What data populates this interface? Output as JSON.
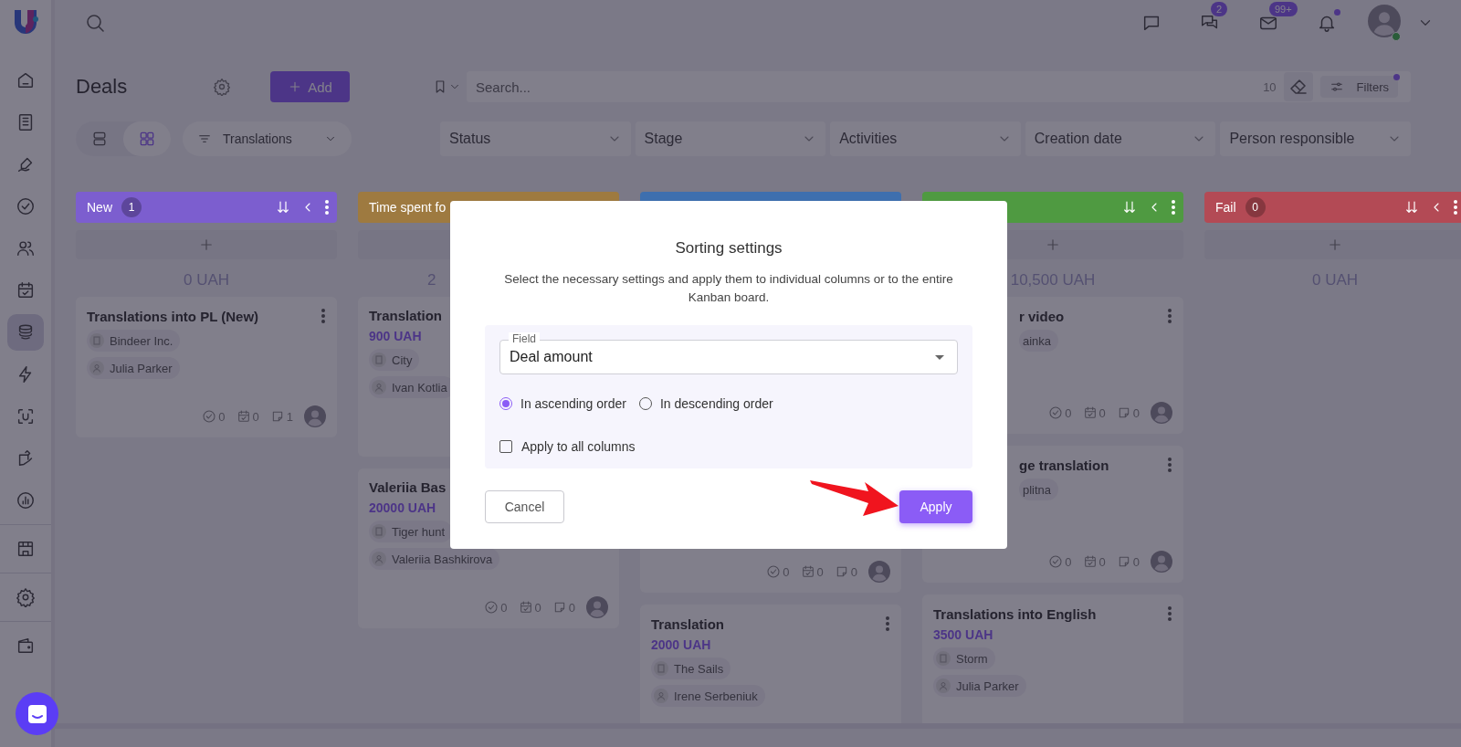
{
  "sidebar": {
    "groups": [
      [
        {
          "selected": false
        },
        {
          "selected": false
        },
        {
          "selected": false
        },
        {
          "selected": false
        },
        {
          "selected": false
        },
        {
          "selected": false
        },
        {
          "selected": true
        },
        {
          "selected": false
        },
        {
          "selected": false
        },
        {
          "selected": false
        },
        {
          "selected": false
        }
      ],
      [
        {
          "selected": false
        }
      ],
      [
        {
          "selected": false
        }
      ],
      [
        {
          "selected": false
        }
      ]
    ]
  },
  "top_actions": [
    {
      "unread": false
    },
    {
      "badge": "2"
    },
    {
      "badge": "99+"
    },
    {
      "unread": true
    }
  ],
  "user": {
    "online": true
  },
  "page": {
    "title": "Deals",
    "add_button": "Add"
  },
  "search": {
    "placeholder": "Search...",
    "count": "10",
    "filters_label": "Filters",
    "filters_active": true
  },
  "view_toggle": [
    {
      "selected": false
    },
    {
      "selected": true
    }
  ],
  "pipeline": {
    "value": "Translations"
  },
  "filters": [
    "Status",
    "Stage",
    "Activities",
    "Creation date",
    "Person responsible"
  ],
  "columns": [
    {
      "title": "New",
      "count": "1",
      "color": "#7c5ecf",
      "actions": true,
      "total": "0 UAH",
      "cards": [
        {
          "title": "Translations into PL (New)",
          "menu": true,
          "company": "Bindeer Inc.",
          "person": "Julia Parker",
          "tasks": "0",
          "events": "0",
          "comments": "1"
        }
      ]
    },
    {
      "title": "Time spent fo",
      "color": "#9e7a40",
      "actions": false,
      "total": "2",
      "cards": [
        {
          "title": "Translation",
          "menu": false,
          "amount": "900 UAH",
          "company": "City",
          "person": "Ivan Kotlia"
        },
        {
          "title": "Valeriia Bas",
          "menu": false,
          "amount": "20000 UAH",
          "company": "Tiger hunt",
          "person": "Valeriia Bashkirova",
          "tasks": "0",
          "events": "0",
          "comments": "0"
        }
      ]
    },
    {
      "color": "#3e6fae",
      "actions": false,
      "cards": [
        {
          "tasks": "0",
          "events": "0",
          "comments": "0"
        },
        {
          "title": "Translation",
          "menu": true,
          "amount": "2000 UAH",
          "company": "The Sails",
          "person": "Irene Serbeniuk"
        }
      ]
    },
    {
      "color": "#4f9a41",
      "actions": true,
      "total": "10,500 UAH",
      "cards": [
        {
          "title": "r video",
          "menu": true,
          "person": "ainka",
          "tasks": "0",
          "events": "0",
          "comments": "0"
        },
        {
          "title": "ge translation",
          "menu": true,
          "person": "plitna",
          "tasks": "0",
          "events": "0",
          "comments": "0"
        },
        {
          "title": "Translations into English",
          "menu": true,
          "amount": "3500 UAH",
          "company": "Storm",
          "person": "Julia Parker"
        }
      ]
    },
    {
      "title": "Fail",
      "count": "0",
      "color": "#b34a55",
      "actions": true,
      "total": "0 UAH"
    }
  ],
  "modal": {
    "title": "Sorting settings",
    "description": "Select the necessary settings and apply them to individual columns or to the entire Kanban board.",
    "field": {
      "label": "Field",
      "value": "Deal amount"
    },
    "order_options": [
      {
        "label": "In ascending order",
        "selected": true
      },
      {
        "label": "In descending order",
        "selected": false
      }
    ],
    "apply_all": {
      "label": "Apply to all columns",
      "checked": false
    },
    "buttons": {
      "cancel": "Cancel",
      "apply": "Apply"
    }
  }
}
